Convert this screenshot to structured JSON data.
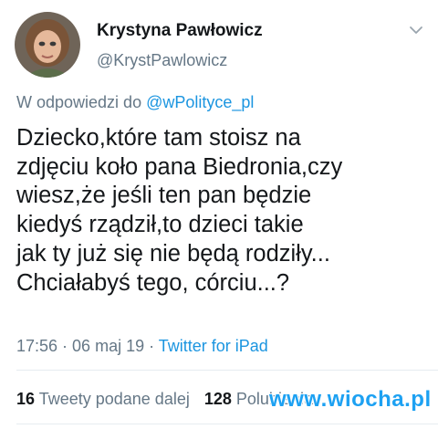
{
  "author": {
    "name": "Krystyna Pawłowicz",
    "handle": "@KrystPawlowicz",
    "avatar_icon": "profile-photo"
  },
  "menu_icon": "chevron-down-icon",
  "reply": {
    "prefix": "W odpowiedzi do ",
    "mention": "@wPolityce_pl"
  },
  "tweet": {
    "lines": [
      "Dziecko,które tam stoisz na",
      "zdjęciu koło pana Biedronia,czy",
      "wiesz,że jeśli ten pan będzie",
      "kiedyś rządził,to dzieci takie",
      "jak ty już się nie będą rodziły...",
      "Chciałabyś tego, córciu...?"
    ]
  },
  "meta": {
    "time": "17:56",
    "separator": " · ",
    "date": "06 maj 19",
    "source": "Twitter for iPad"
  },
  "stats": {
    "retweets_count": "16",
    "retweets_label": "Tweety podane dalej",
    "likes_count": "128",
    "likes_label": "Polubienia"
  },
  "watermark": "www.wiocha.pl",
  "colors": {
    "link": "#1b95e0",
    "secondary_text": "#657786",
    "primary_text": "#14171a",
    "divider": "#e6ecf0"
  }
}
